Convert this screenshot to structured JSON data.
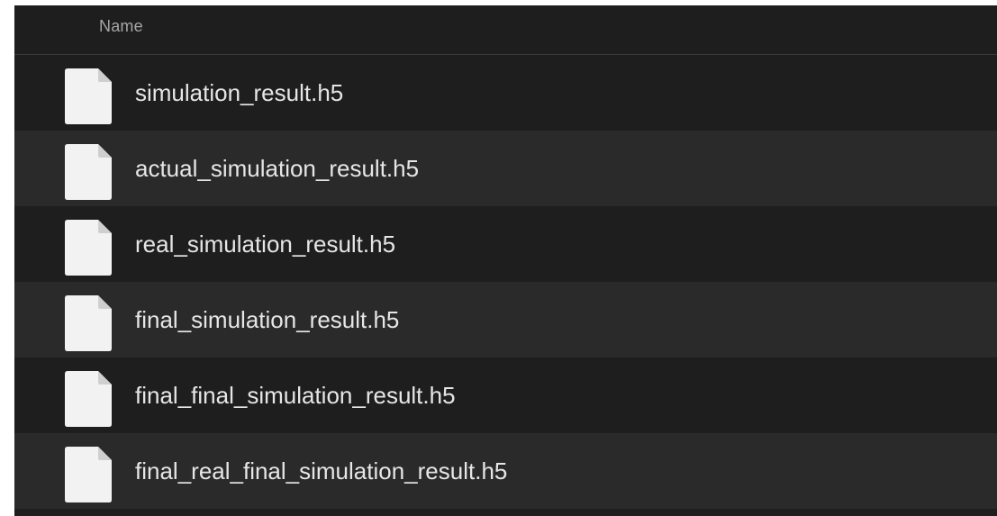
{
  "header": {
    "name_column": "Name"
  },
  "files": [
    {
      "name": "simulation_result.h5",
      "icon": "document-icon"
    },
    {
      "name": "actual_simulation_result.h5",
      "icon": "document-icon"
    },
    {
      "name": "real_simulation_result.h5",
      "icon": "document-icon"
    },
    {
      "name": "final_simulation_result.h5",
      "icon": "document-icon"
    },
    {
      "name": "final_final_simulation_result.h5",
      "icon": "document-icon"
    },
    {
      "name": "final_real_final_simulation_result.h5",
      "icon": "document-icon"
    }
  ],
  "colors": {
    "background": "#1e1e1e",
    "alternate_row": "#2a2a2a",
    "text": "#e6e6e6",
    "header_text": "#a6a6a6",
    "icon_fill": "#f2f2f2"
  }
}
